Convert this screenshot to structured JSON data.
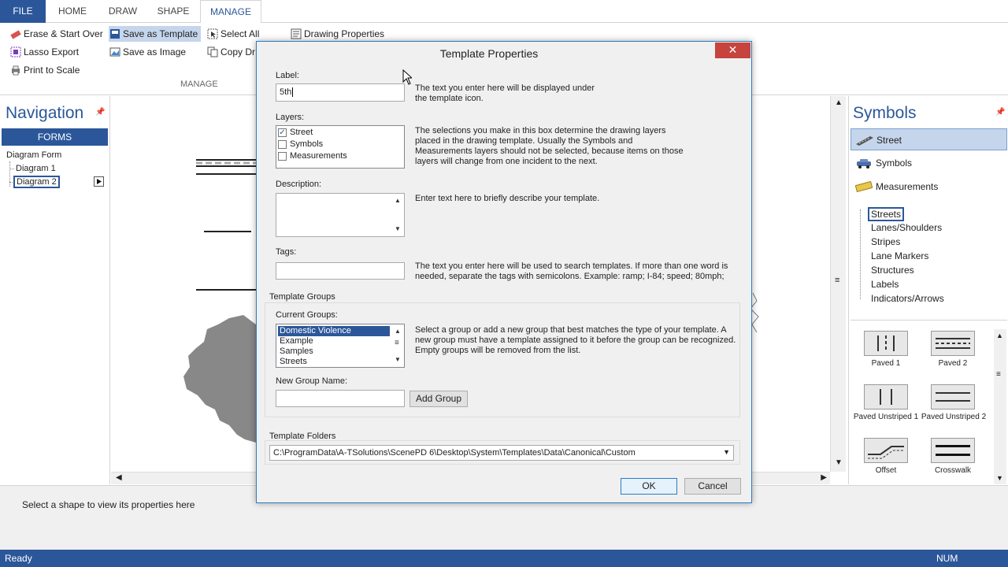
{
  "ribbon": {
    "tabs": [
      "FILE",
      "HOME",
      "DRAW",
      "SHAPE",
      "MANAGE"
    ],
    "active_tab": "MANAGE",
    "buttons": {
      "erase": "Erase & Start Over",
      "lasso": "Lasso Export",
      "print": "Print to Scale",
      "save_template": "Save as Template",
      "save_image": "Save as Image",
      "select_all": "Select All",
      "copy_drawing": "Copy Dr",
      "drawing_properties": "Drawing Properties"
    },
    "group_label": "MANAGE"
  },
  "navigation": {
    "title": "Navigation",
    "forms_label": "FORMS",
    "tree": {
      "root": "Diagram Form",
      "items": [
        "Diagram 1",
        "Diagram 2"
      ],
      "selected": "Diagram 2"
    }
  },
  "symbols": {
    "title": "Symbols",
    "categories": [
      "Street",
      "Symbols",
      "Measurements"
    ],
    "selected_category": "Street",
    "subcategories": [
      "Streets",
      "Lanes/Shoulders",
      "Stripes",
      "Lane Markers",
      "Structures",
      "Labels",
      "Indicators/Arrows"
    ],
    "selected_subcategory": "Streets",
    "tiles": [
      "Paved 1",
      "Paved 2",
      "Paved Unstriped 1",
      "Paved Unstriped 2",
      "Offset",
      "Crosswalk"
    ]
  },
  "properties": {
    "hint": "Select a shape to view its properties here"
  },
  "status": {
    "left": "Ready",
    "right": "NUM"
  },
  "dialog": {
    "title": "Template Properties",
    "close": "✕",
    "label": {
      "caption": "Label:",
      "value": "5th",
      "help_1": "The text you enter here will be displayed under",
      "help_2": "the template icon."
    },
    "layers": {
      "caption": "Layers:",
      "items": [
        {
          "name": "Street",
          "checked": "✓"
        },
        {
          "name": "Symbols",
          "checked": ""
        },
        {
          "name": "Measurements",
          "checked": ""
        }
      ],
      "help_1": "The selections you make in this box determine the drawing layers",
      "help_2": "placed in the drawing template. Usually the Symbols and",
      "help_3": "Measurements layers should not be selected, because items on those",
      "help_4": "layers will change from one incident to the next."
    },
    "description": {
      "caption": "Description:",
      "value": "",
      "help": "Enter text here to briefly describe your template."
    },
    "tags": {
      "caption": "Tags:",
      "value": "",
      "help_1": "The text you enter here will be used to search templates.  If more than one word is",
      "help_2": "needed, separate the tags with semicolons.  Example:  ramp; I-84; speed; 80mph;"
    },
    "groups": {
      "section": "Template Groups",
      "caption": "Current Groups:",
      "items": [
        "Domestic Violence",
        "Example",
        "Samples",
        "Streets"
      ],
      "selected": "Domestic Violence",
      "help_1": "Select a group or add a new group that best matches the type of your template.  A",
      "help_2": "new group must have a template assigned to it before the group can be recognized.",
      "help_3": "Empty groups will be removed from the list.",
      "new_group_caption": "New Group Name:",
      "new_group_value": "",
      "add_button": "Add Group"
    },
    "folders": {
      "section": "Template Folders",
      "path": "C:\\ProgramData\\A-TSolutions\\ScenePD 6\\Desktop\\System\\Templates\\Data\\Canonical\\Custom"
    },
    "ok": "OK",
    "cancel": "Cancel"
  },
  "colors": {
    "accent": "#2b579a",
    "selection": "#c5d5ec",
    "close_red": "#c7433d"
  }
}
